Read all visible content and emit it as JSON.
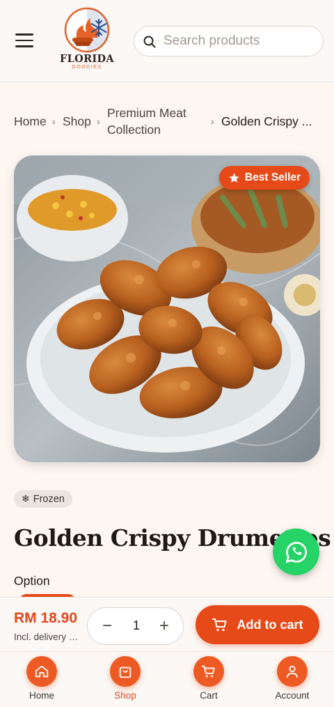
{
  "header": {
    "logo_text": "FLORIDA",
    "logo_sub": "GOODIES",
    "search_placeholder": "Search products"
  },
  "breadcrumb": {
    "home": "Home",
    "shop": "Shop",
    "category_line1": "Premium Meat",
    "category_line2": "Collection",
    "current": "Golden Crispy ..."
  },
  "product": {
    "badge": "Best Seller",
    "storage_chip": "Frozen",
    "title": "Golden Crispy Drumettes",
    "option_label": "Option",
    "price": "RM 18.90",
    "price_note": "Incl. delivery fee",
    "quantity": "1",
    "add_to_cart": "Add to cart"
  },
  "bottom_nav": [
    {
      "label": "Home",
      "icon": "home-icon",
      "active": false
    },
    {
      "label": "Shop",
      "icon": "shopping-bag-icon",
      "active": true
    },
    {
      "label": "Cart",
      "icon": "cart-icon",
      "active": false
    },
    {
      "label": "Account",
      "icon": "user-icon",
      "active": false
    }
  ],
  "colors": {
    "accent": "#e64a19",
    "whatsapp": "#25d366",
    "background": "#fdf6f1"
  }
}
